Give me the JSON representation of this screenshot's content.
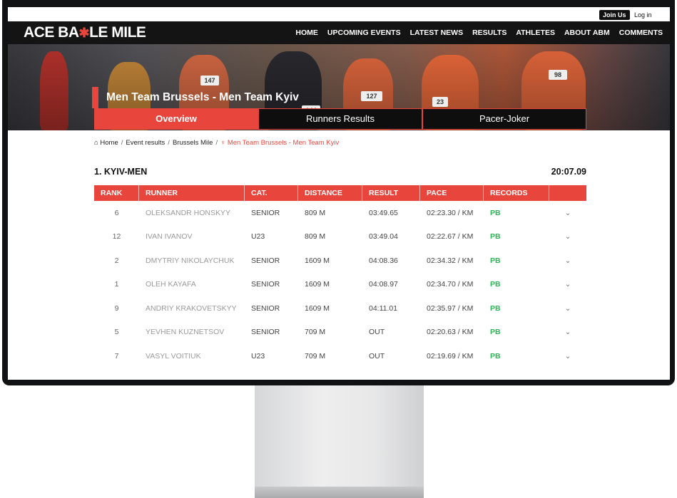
{
  "top": {
    "join": "Join Us",
    "login": "Log in"
  },
  "nav": {
    "logo_a": "ACE BA",
    "logo_b": "LE MILE",
    "items": [
      "HOME",
      "UPCOMING EVENTS",
      "LATEST NEWS",
      "RESULTS",
      "ATHLETES",
      "ABOUT ABM",
      "COMMENTS"
    ]
  },
  "hero": {
    "title": "Men Team Brussels - Men Team Kyiv",
    "bibs": [
      "147",
      "127",
      "23",
      "144",
      "98"
    ]
  },
  "tabs": [
    "Overview",
    "Runners Results",
    "Pacer-Joker"
  ],
  "breadcrumb": [
    "Home",
    "Event results",
    "Brussels Mile",
    "Men Team Brussels - Men Team Kyiv"
  ],
  "team": {
    "name": "1. KYIV-MEN",
    "time": "20:07.09"
  },
  "table": {
    "headers": [
      "RANK",
      "RUNNER",
      "CAT.",
      "DISTANCE",
      "RESULT",
      "PACE",
      "RECORDS",
      ""
    ],
    "rows": [
      [
        "6",
        "OLEKSANDR HONSKYY",
        "SENIOR",
        "809 M",
        "03:49.65",
        "02:23.30 / KM",
        "PB",
        "⌄"
      ],
      [
        "12",
        "IVAN IVANOV",
        "U23",
        "809 M",
        "03:49.04",
        "02:22.67 / KM",
        "PB",
        "⌄"
      ],
      [
        "2",
        "DMYTRIY NIKOLAYCHUK",
        "SENIOR",
        "1609 M",
        "04:08.36",
        "02:34.32 / KM",
        "PB",
        "⌄"
      ],
      [
        "1",
        "OLEH KAYAFA",
        "SENIOR",
        "1609 M",
        "04:08.97",
        "02:34.70 / KM",
        "PB",
        "⌄"
      ],
      [
        "9",
        "ANDRIY KRAKOVETSKYY",
        "SENIOR",
        "1609 M",
        "04:11.01",
        "02:35.97 / KM",
        "PB",
        "⌄"
      ],
      [
        "5",
        "YEVHEN KUZNETSOV",
        "SENIOR",
        "709 M",
        "OUT",
        "02:20.63 / KM",
        "PB",
        "⌄"
      ],
      [
        "7",
        "VASYL VOITIUK",
        "U23",
        "709 M",
        "OUT",
        "02:19.69 / KM",
        "PB",
        "⌄"
      ]
    ]
  },
  "colors": {
    "accent": "#e8453c",
    "nav_bg": "#141414",
    "record": "#2eb157"
  }
}
